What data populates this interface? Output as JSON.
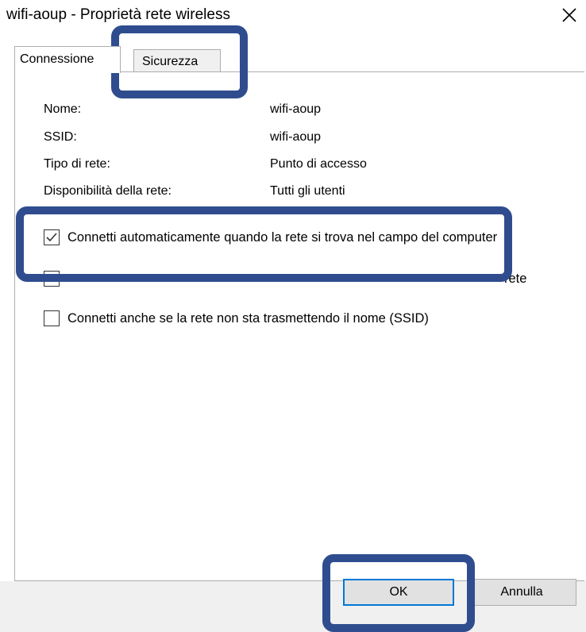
{
  "window": {
    "title": "wifi-aoup - Proprietà rete wireless"
  },
  "tabs": [
    {
      "label": "Connessione",
      "active": true
    },
    {
      "label": "Sicurezza",
      "active": false
    }
  ],
  "properties": [
    {
      "label": "Nome:",
      "value": "wifi-aoup"
    },
    {
      "label": "SSID:",
      "value": "wifi-aoup"
    },
    {
      "label": "Tipo di rete:",
      "value": "Punto di accesso"
    },
    {
      "label": "Disponibilità della rete:",
      "value": "Tutti gli utenti"
    }
  ],
  "options": [
    {
      "label": "Connetti automaticamente quando la rete si trova nel campo del computer",
      "checked": true
    },
    {
      "label": "rete",
      "checked": false
    },
    {
      "label": "Connetti anche se la rete non sta trasmettendo il nome (SSID)",
      "checked": false
    }
  ],
  "buttons": {
    "ok": "OK",
    "cancel": "Annulla"
  },
  "colors": {
    "callout": "#2f4d8e",
    "ok_border": "#0078d7"
  }
}
